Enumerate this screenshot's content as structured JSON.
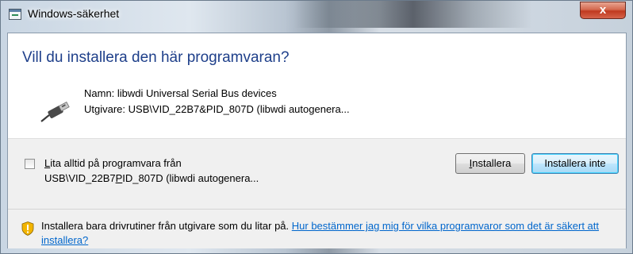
{
  "window": {
    "title": "Windows-säkerhet",
    "close_label": "x"
  },
  "dialog": {
    "question": "Vill du installera den här programvaran?",
    "name_line": "Namn: libwdi Universal Serial Bus devices",
    "publisher_line": "Utgivare: USB\\VID_22B7&PID_807D (libwdi autogenera..."
  },
  "trust": {
    "label_prefix_underlined": "L",
    "label_rest": "ita alltid på programvara från",
    "source_prefix": "USB\\VID_22B7",
    "source_underlined": "P",
    "source_rest": "ID_807D (libwdi autogenera...",
    "checked": false
  },
  "buttons": {
    "install_underlined": "I",
    "install_rest": "nstallera",
    "dont_install_label": "Installera inte"
  },
  "warning": {
    "text": "Installera bara drivrutiner från utgivare som du litar på. ",
    "link": "Hur bestämmer jag mig för vilka programvaror som det är säkert att installera?"
  },
  "colors": {
    "question": "#1e3f8a",
    "link": "#0066cc",
    "close_button": "#c0391f"
  },
  "icons": {
    "app": "security-dialog-icon",
    "device": "usb-cable-icon",
    "warning": "shield-warning-icon"
  }
}
